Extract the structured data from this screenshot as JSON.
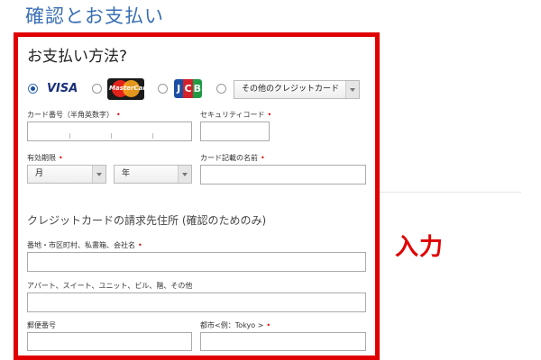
{
  "page_title": "確認とお支払い",
  "annotation": "入力",
  "payment": {
    "section_title": "お支払い方法?",
    "options": [
      {
        "label": "VISA",
        "icon": "visa-logo",
        "selected": true
      },
      {
        "label": "MasterCard",
        "icon": "mastercard-logo",
        "selected": false
      },
      {
        "label": "JCB",
        "icon": "jcb-logo",
        "selected": false
      }
    ],
    "other_cards_select": "その他のクレジットカード",
    "card_number_label": "カード番号（半角英数字）",
    "security_code_label": "セキュリティコード",
    "expiry_label": "有効期限",
    "month_select": "月",
    "year_select": "年",
    "cardholder_label": "カード記載の名前",
    "required_mark": "•"
  },
  "billing": {
    "title": "クレジットカードの請求先住所 (確認のためのみ)",
    "address1_label": "番地・市区町村、私書箱、会社名",
    "address2_label": "アパート、スイート、ユニット、ビル、階、その他",
    "postal_label": "郵便番号",
    "city_label": "都市<例：Tokyo >"
  },
  "colors": {
    "title_blue": "#3a6fb4",
    "highlight_red": "#e00000"
  }
}
